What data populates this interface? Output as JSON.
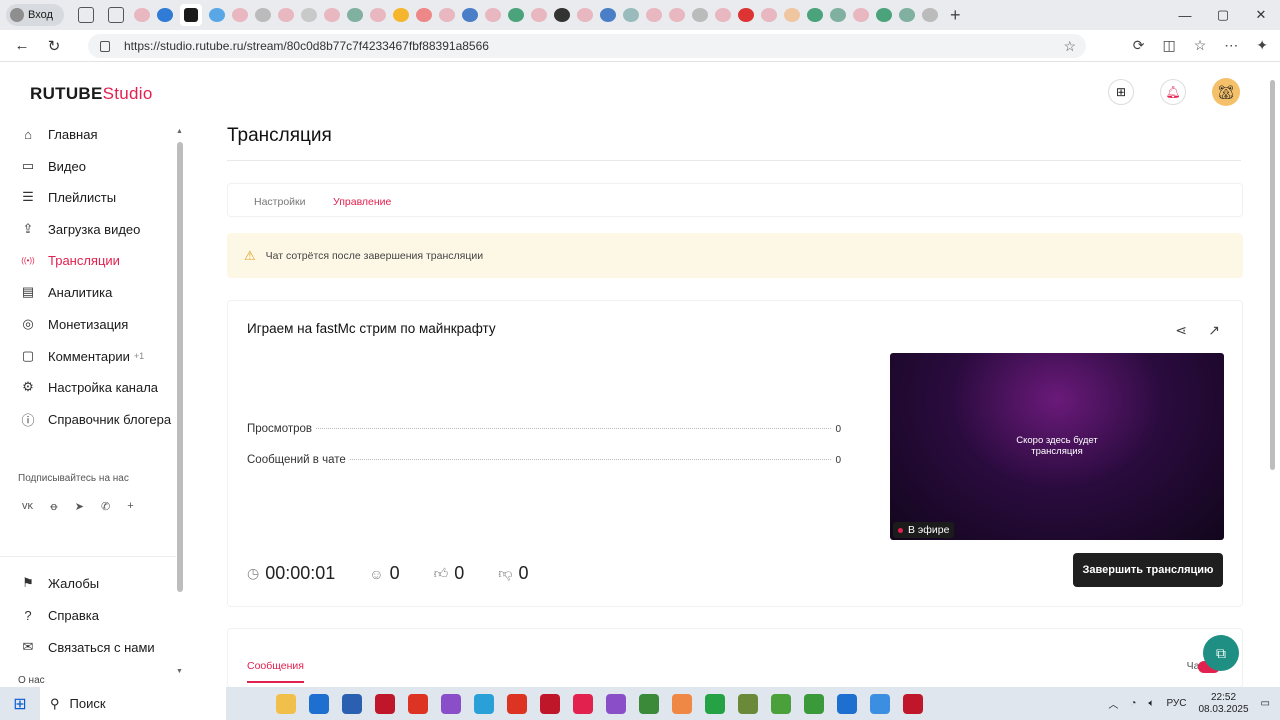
{
  "browser": {
    "profile_label": "Вход",
    "url": "https://studio.rutube.ru/stream/80c0d8b77c7f4233467fbf88391a8566",
    "tab_colors": [
      "#e8b7c0",
      "#2f7bd5",
      "#f0c04a",
      "#5aa7e8",
      "#e8b7c0",
      "#bbb",
      "#e8b7c0",
      "#c9c9c9",
      "#e8b7c0",
      "#7fb0a0",
      "#e8b7c0",
      "#f5b62e",
      "#e88",
      "#e8b7c0",
      "#4a7fc8",
      "#e8b7c0",
      "#4aa37a",
      "#e8b7c0",
      "#333",
      "#e8b7c0",
      "#4a7fc8",
      "#9bb",
      "#e8b7c0",
      "#e8b7c0",
      "#bbb",
      "#e8b7c0",
      "#d33",
      "#e8b7c0",
      "#f0c6a0",
      "#4aa37a",
      "#7fb0a0",
      "#e8b7c0",
      "#4aa37a",
      "#7fb0a0",
      "#bbb"
    ]
  },
  "brand": {
    "logo_main": "RUTUBE",
    "logo_studio": "Studio"
  },
  "sidebar": {
    "items": [
      {
        "label": "Главная",
        "icon": "home-icon",
        "glyph": "⌂"
      },
      {
        "label": "Видео",
        "icon": "video-icon",
        "glyph": "▭"
      },
      {
        "label": "Плейлисты",
        "icon": "playlist-icon",
        "glyph": "☰"
      },
      {
        "label": "Загрузка видео",
        "icon": "upload-icon",
        "glyph": "⇪"
      },
      {
        "label": "Трансляции",
        "icon": "broadcast-icon",
        "glyph": "((•))"
      },
      {
        "label": "Аналитика",
        "icon": "analytics-icon",
        "glyph": "▤"
      },
      {
        "label": "Монетизация",
        "icon": "coin-icon",
        "glyph": "◎"
      },
      {
        "label": "Комментарии",
        "icon": "comment-icon",
        "glyph": "▢",
        "badge": "+1"
      },
      {
        "label": "Настройка канала",
        "icon": "settings-icon",
        "glyph": "⚙"
      },
      {
        "label": "Справочник блогера",
        "icon": "info-icon",
        "glyph": "ⓘ"
      }
    ],
    "subscribe_label": "Подписывайтесь на нас",
    "social": [
      "vk-icon",
      "ok-icon",
      "telegram-icon",
      "viber-icon",
      "more-icon"
    ],
    "social_glyphs": [
      "ᴠᴋ",
      "ꝋ",
      "➤",
      "✆",
      "+"
    ],
    "bottom_items": [
      {
        "label": "Жалобы",
        "icon": "flag-icon",
        "glyph": "⚑"
      },
      {
        "label": "Справка",
        "icon": "help-icon",
        "glyph": "?"
      },
      {
        "label": "Связаться с нами",
        "icon": "mail-icon",
        "glyph": "✉"
      }
    ],
    "cutoff_label": "О нас"
  },
  "page": {
    "title": "Трансляция",
    "tabs": [
      "Настройки",
      "Управление"
    ],
    "active_tab": "Управление",
    "notice": "Чат сотрётся после завершения трансляции"
  },
  "stream": {
    "title": "Играем на fastMc стрим по майнкрафту",
    "stats": [
      {
        "label": "Просмотров",
        "value": "0"
      },
      {
        "label": "Сообщений в чате",
        "value": "0"
      }
    ],
    "preview_message_line1": "Скоро здесь будет",
    "preview_message_line2": "трансляция",
    "live_label": "В эфире",
    "timer": "00:00:01",
    "viewers": "0",
    "likes": "0",
    "dislikes": "0",
    "end_button": "Завершить трансляцию"
  },
  "messages": {
    "tab_label": "Сообщения",
    "chat_label": "Чат"
  },
  "taskbar": {
    "search_label": "Поиск",
    "app_colors": [
      "#f0c04a",
      "#1e6fd0",
      "#2b5fb0",
      "#c0162a",
      "#d32",
      "#8a4fc8",
      "#2aa0d8",
      "#d32",
      "#c0162a",
      "#e3214f",
      "#8a4fc8",
      "#3a8a3a",
      "#e84",
      "#25a244",
      "#6a8a3a",
      "#4aa03a",
      "#3a9a3a",
      "#1e6fd0",
      "#3b8ee0",
      "#c0162a"
    ],
    "lang": "РУС",
    "time": "22:52",
    "date": "08.03.2025"
  }
}
